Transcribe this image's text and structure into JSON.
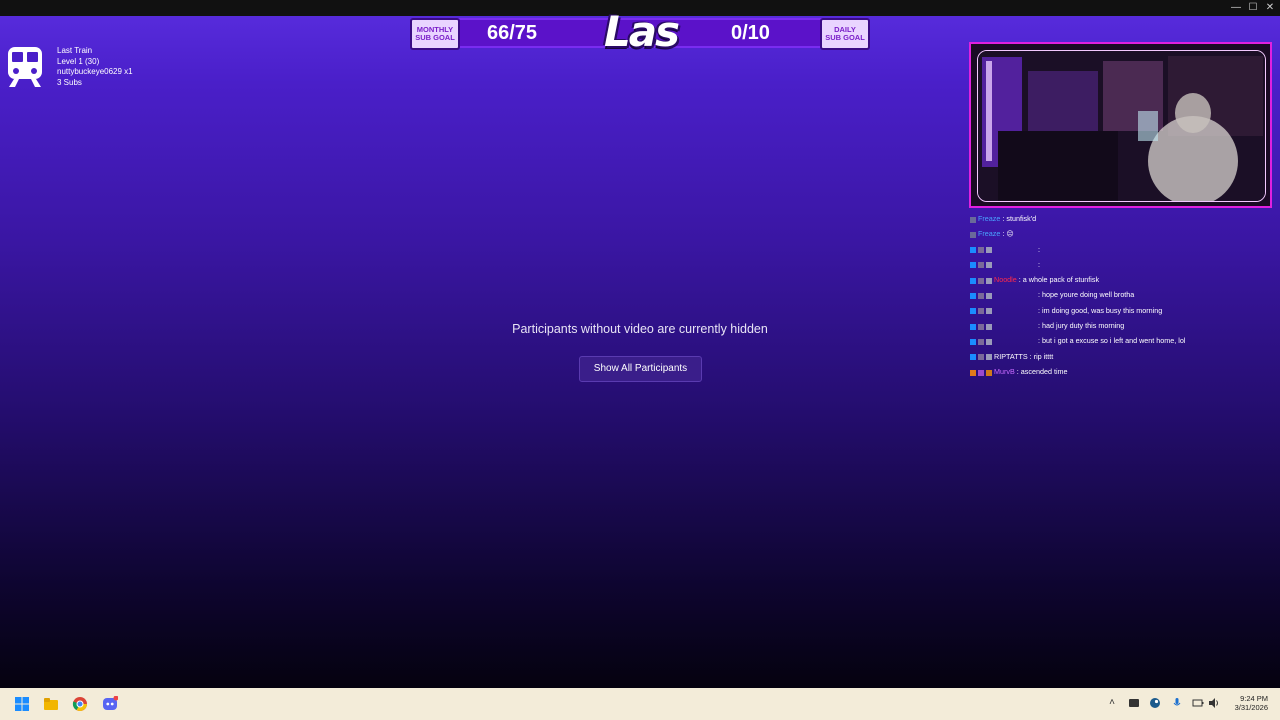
{
  "window": {
    "controls": [
      "—",
      "☐",
      "✕"
    ]
  },
  "train": {
    "icon": "train-icon",
    "title": "Last Train",
    "level": "Level 1  (30)",
    "user": "nuttybuckeye0629 x1",
    "subs": "3 Subs"
  },
  "goals": {
    "monthly_label_1": "MONTHLY",
    "monthly_label_2": "SUB GOAL",
    "monthly_value": "66/75",
    "logo": "Las",
    "daily_value": "0/10",
    "daily_label_1": "DAILY",
    "daily_label_2": "SUB GOAL"
  },
  "main": {
    "message": "Participants without video are currently hidden",
    "show_button": "Show All Participants"
  },
  "chat": [
    {
      "user": "Freaze",
      "sep": " : ",
      "text": "stunfisk'd",
      "color": "#4aa3ff"
    },
    {
      "user": "Freaze",
      "sep": " : ",
      "text": "☹",
      "color": "#4aa3ff"
    },
    {
      "user": "",
      "sep": " : ",
      "text": "",
      "color": "#ffffff"
    },
    {
      "user": "",
      "sep": " : ",
      "text": "",
      "color": "#ffffff"
    },
    {
      "user": "Noodle",
      "sep": " : ",
      "text": "a whole pack of stunfisk",
      "color": "#ff2a4a"
    },
    {
      "user": "",
      "sep": " : ",
      "text": "hope youre doing well brotha",
      "color": "#ffffff"
    },
    {
      "user": "",
      "sep": " : ",
      "text": "im doing good, was busy this morning",
      "color": "#ffffff"
    },
    {
      "user": "",
      "sep": " : ",
      "text": "had jury duty this morning",
      "color": "#ffffff"
    },
    {
      "user": "",
      "sep": " : ",
      "text": "but i got a excuse so i left and went home, lol",
      "color": "#ffffff"
    },
    {
      "user": "RIPTATTS",
      "sep": " : ",
      "text": "rip itttt",
      "color": "#ffffff"
    },
    {
      "user": "MurvB",
      "sep": " : ",
      "text": "ascended time",
      "color": "#c86bff"
    }
  ],
  "taskbar": {
    "apps": [
      "windows-start-icon",
      "file-explorer-icon",
      "chrome-icon",
      "discord-icon"
    ],
    "tray": [
      "chevron-up-icon",
      "tray-app-icon",
      "steam-icon",
      "mic-icon",
      "battery-icon",
      "volume-icon"
    ],
    "time": "9:24 PM",
    "date": "3/31/2026"
  },
  "colors": {
    "accent": "#5b12c9",
    "cam_border": "#e020e0",
    "chat_blue": "#4aa3ff"
  }
}
